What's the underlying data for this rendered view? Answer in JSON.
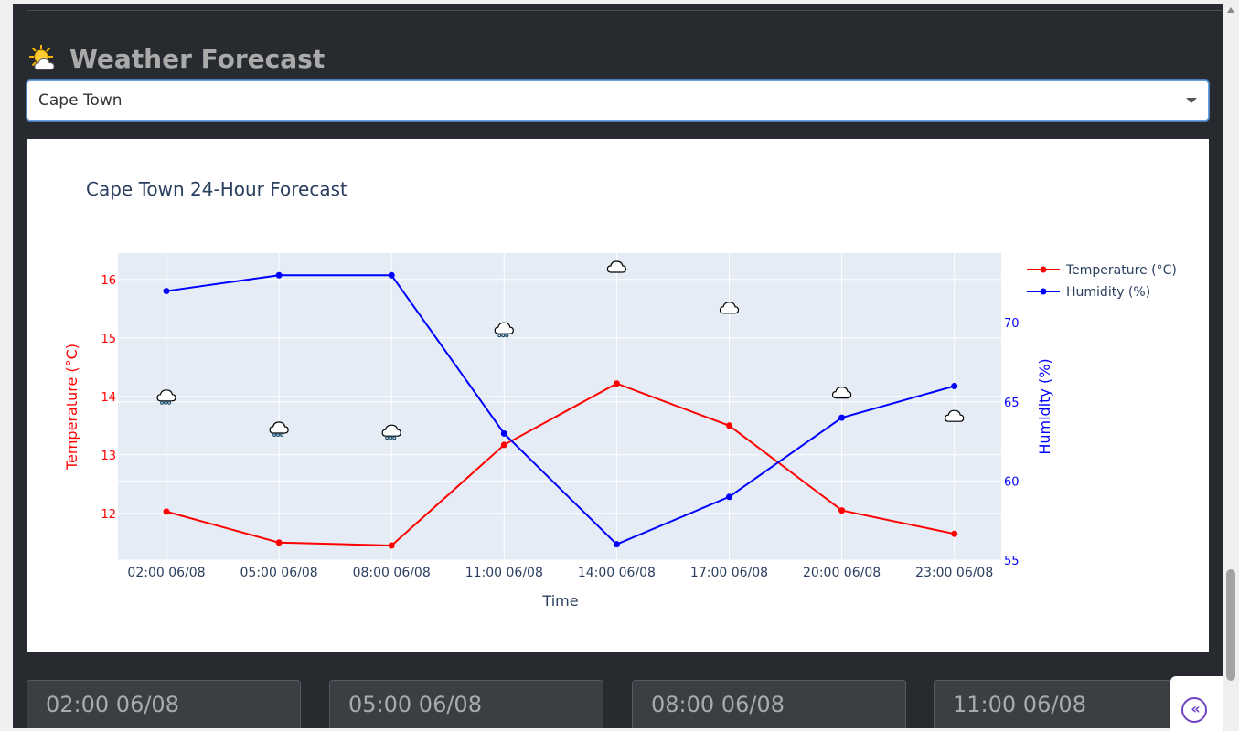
{
  "header": {
    "title": "Weather Forecast",
    "icon": "sun-behind-cloud-icon"
  },
  "city_select": {
    "value": "Cape Town"
  },
  "chart_data": {
    "type": "line",
    "title": "Cape Town 24-Hour Forecast",
    "xlabel": "Time",
    "categories": [
      "02:00 06/08",
      "05:00 06/08",
      "08:00 06/08",
      "11:00 06/08",
      "14:00 06/08",
      "17:00 06/08",
      "20:00 06/08",
      "23:00 06/08"
    ],
    "series": [
      {
        "name": "Temperature (°C)",
        "axis": "y1",
        "color": "#ff0000",
        "values": [
          12.03,
          11.5,
          11.45,
          13.17,
          14.22,
          13.5,
          12.05,
          11.65
        ]
      },
      {
        "name": "Humidity (%)",
        "axis": "y2",
        "color": "#0000ff",
        "values": [
          72,
          73,
          73,
          63,
          56,
          59,
          64,
          66
        ]
      }
    ],
    "y1": {
      "label": "Temperature (°C)",
      "ticks": [
        12,
        13,
        14,
        15,
        16
      ],
      "range": [
        11.2,
        16.45
      ]
    },
    "y2": {
      "label": "Humidity (%)",
      "ticks": [
        55,
        60,
        65,
        70
      ],
      "range": [
        55,
        74.4
      ]
    },
    "weather_icons": [
      {
        "icon": "rain-cloud-icon",
        "temp": 14.0
      },
      {
        "icon": "rain-cloud-icon",
        "temp": 13.45
      },
      {
        "icon": "rain-cloud-icon",
        "temp": 13.4
      },
      {
        "icon": "rain-cloud-icon",
        "temp": 15.15
      },
      {
        "icon": "cloud-icon",
        "temp": 16.2
      },
      {
        "icon": "cloud-icon",
        "temp": 15.5
      },
      {
        "icon": "cloud-icon",
        "temp": 14.05
      },
      {
        "icon": "cloud-icon",
        "temp": 13.65
      }
    ],
    "legend_position": "top-right",
    "grid": true
  },
  "cards": [
    {
      "time": "02:00 06/08"
    },
    {
      "time": "05:00 06/08"
    },
    {
      "time": "08:00 06/08"
    },
    {
      "time": "11:00 06/08"
    }
  ],
  "collapse_button": {
    "label": "«"
  }
}
